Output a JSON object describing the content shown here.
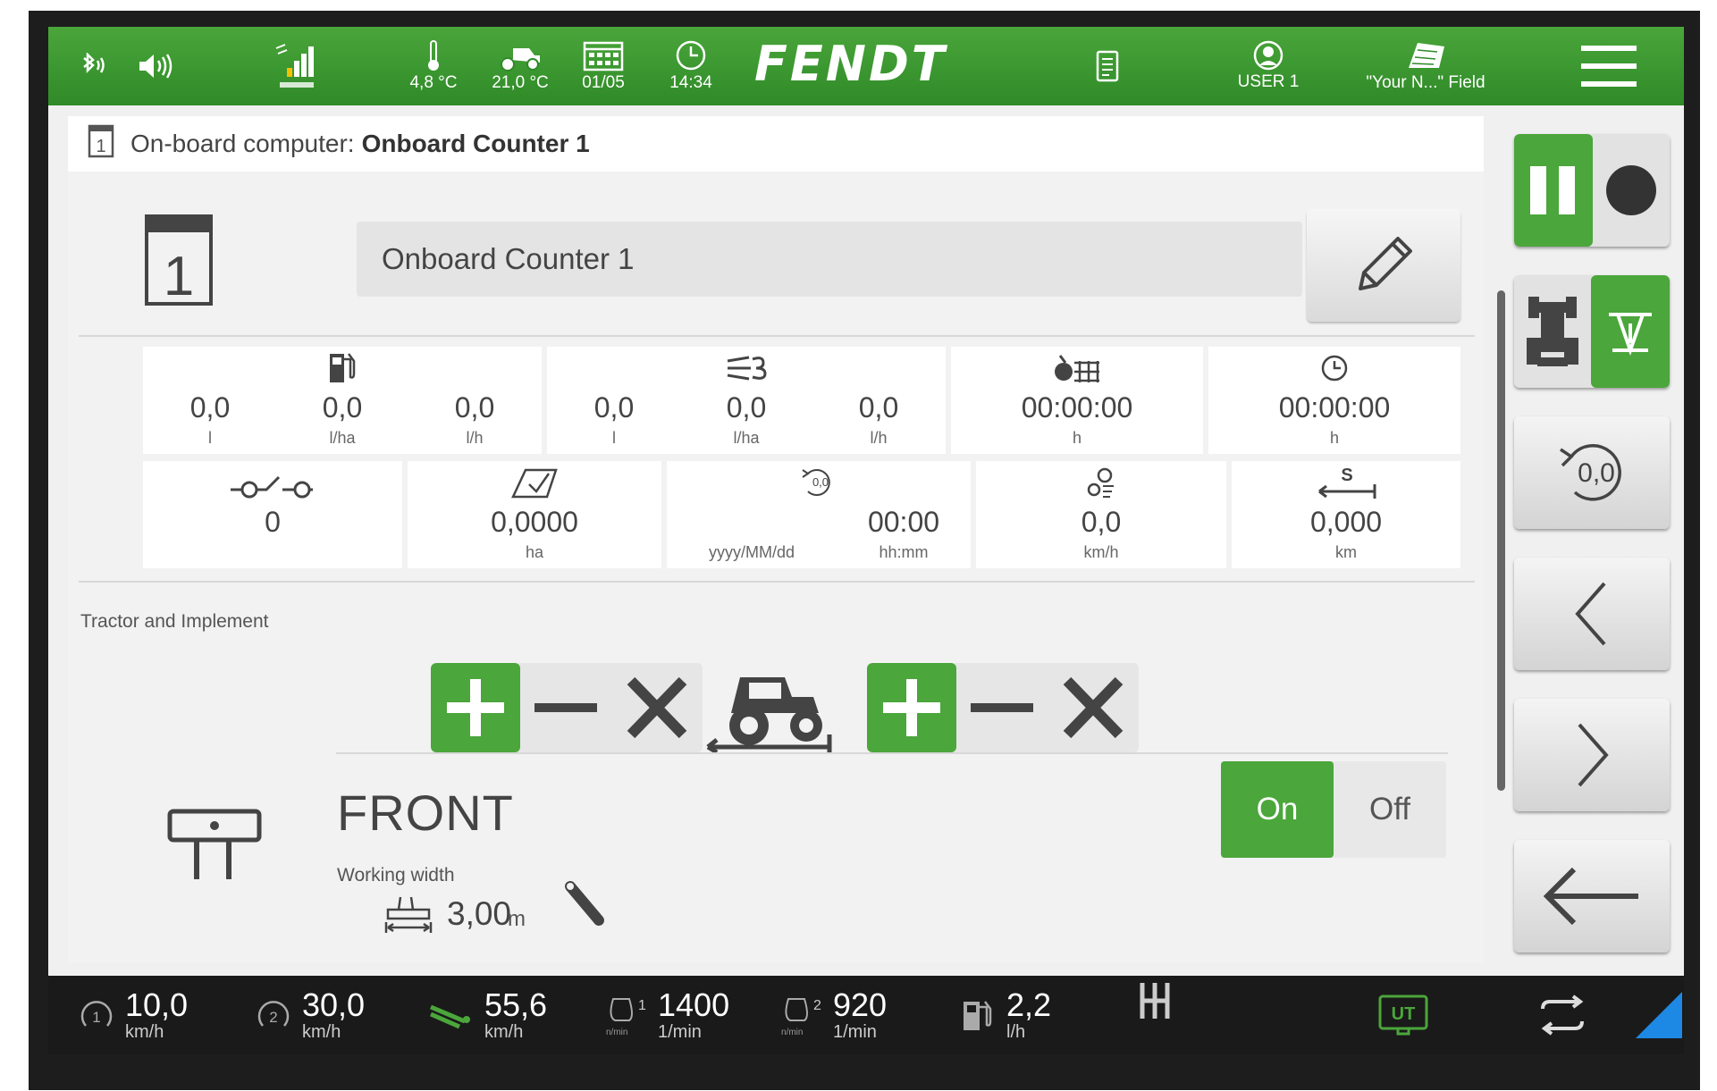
{
  "topbar": {
    "temp_ambient": "4,8 °C",
    "temp_oil": "21,0 °C",
    "date": "01/05",
    "time": "14:34",
    "brand": "FENDT",
    "user": "USER 1",
    "field": "\"Your N...\" Field"
  },
  "header": {
    "prefix": "On-board computer:",
    "name": "Onboard Counter 1"
  },
  "counter_icon_digit": "1",
  "counter_name_value": "Onboard Counter 1",
  "row1": {
    "fuel": [
      {
        "value": "0,0",
        "unit": "l"
      },
      {
        "value": "0,0",
        "unit": "l/ha"
      },
      {
        "value": "0,0",
        "unit": "l/h"
      }
    ],
    "def": [
      {
        "value": "0,0",
        "unit": "l"
      },
      {
        "value": "0,0",
        "unit": "l/ha"
      },
      {
        "value": "0,0",
        "unit": "l/h"
      }
    ],
    "work_hours": {
      "value": "00:00:00",
      "unit": "h"
    },
    "total_hours": {
      "value": "00:00:00",
      "unit": "h"
    }
  },
  "row2": {
    "count": {
      "value": "0"
    },
    "area": {
      "value": "0,0000",
      "unit": "ha"
    },
    "reset": {
      "date_unit": "yyyy/MM/dd",
      "time": "00:00",
      "time_unit": "hh:mm",
      "icon_text": "0,0"
    },
    "speed": {
      "value": "0,0",
      "unit": "km/h"
    },
    "distance": {
      "value": "0,000",
      "unit": "km",
      "icon_text": "S"
    }
  },
  "section_label": "Tractor and Implement",
  "implement": {
    "title": "FRONT",
    "working_width_label": "Working width",
    "working_width_value": "3,00",
    "working_width_unit": "m",
    "on_label": "On",
    "off_label": "Off",
    "state": "On"
  },
  "right_panel": {
    "reset_text": "0,0"
  },
  "bottombar": {
    "speed1": {
      "value": "10,0",
      "unit": "km/h",
      "badge": "1"
    },
    "speed2": {
      "value": "30,0",
      "unit": "km/h",
      "badge": "2"
    },
    "speed_actual": {
      "value": "55,6",
      "unit": "km/h"
    },
    "rpm1": {
      "value": "1400",
      "unit": "1/min",
      "badge": "1",
      "small": "n/min"
    },
    "rpm2": {
      "value": "920",
      "unit": "1/min",
      "badge": "2",
      "small": "n/min"
    },
    "fuel_rate": {
      "value": "2,2",
      "unit": "l/h"
    },
    "ut_label": "UT"
  },
  "colors": {
    "accent_green": "#4ba63b",
    "topbar_green": "#3a9a30",
    "bottombar": "#1a1a1a",
    "corner_blue": "#1e88e5"
  }
}
